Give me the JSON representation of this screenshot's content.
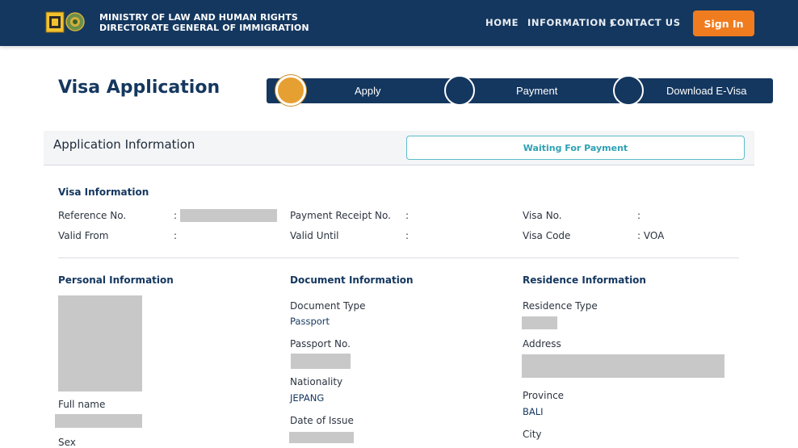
{
  "header": {
    "ministry_line1": "MINISTRY OF  LAW  AND HUMAN RIGHTS",
    "ministry_line2": "DIRECTORATE GENERAL OF IMMIGRATION",
    "nav": {
      "home": "HOME",
      "information": "INFORMATION",
      "contact": "CONTACT US"
    },
    "signin_label": "Sign In",
    "colors": {
      "navy": "#14375f",
      "orange": "#f07c20"
    }
  },
  "page": {
    "title": "Visa Application"
  },
  "stepper": {
    "steps": [
      {
        "label": "Apply",
        "active": true
      },
      {
        "label": "Payment",
        "active": false
      },
      {
        "label": "Download E-Visa",
        "active": false
      }
    ],
    "active_color": "#e6a032"
  },
  "application_info": {
    "title": "Application Information",
    "status": "Waiting For Payment",
    "status_color": "#2ea1b4"
  },
  "visa_info": {
    "heading": "Visa Information",
    "fields": {
      "reference_no": {
        "label": "Reference No.",
        "sep": ":"
      },
      "payment_receipt_no": {
        "label": "Payment Receipt No.",
        "sep": ":"
      },
      "visa_no": {
        "label": "Visa No.",
        "sep": ":"
      },
      "valid_from": {
        "label": "Valid From",
        "sep": ":"
      },
      "valid_until": {
        "label": "Valid Until",
        "sep": ":"
      },
      "visa_code": {
        "label": "Visa Code",
        "sep": ": VOA"
      }
    }
  },
  "personal_info": {
    "heading": "Personal Information",
    "full_name_label": "Full name",
    "sex_label": "Sex"
  },
  "document_info": {
    "heading": "Document Information",
    "document_type_label": "Document Type",
    "document_type_value": "Passport",
    "passport_no_label": "Passport No.",
    "nationality_label": "Nationality",
    "nationality_value": "JEPANG",
    "date_of_issue_label": "Date of Issue"
  },
  "residence_info": {
    "heading": "Residence Information",
    "residence_type_label": "Residence Type",
    "address_label": "Address",
    "province_label": "Province",
    "province_value": "BALI",
    "city_label": "City"
  }
}
